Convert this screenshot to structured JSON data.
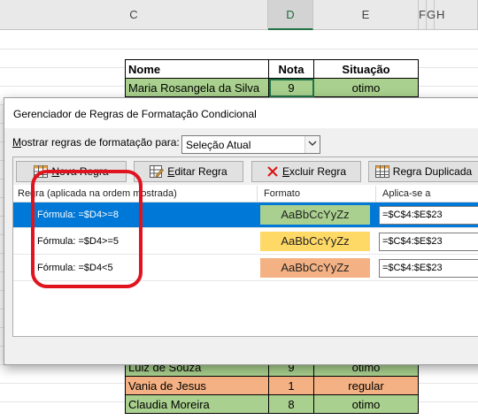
{
  "sheet": {
    "columns": [
      "C",
      "D",
      "E",
      "F",
      "G",
      "H"
    ],
    "table_header": {
      "name": "Nome",
      "grade": "Nota",
      "status": "Situação"
    },
    "rows_top": [
      {
        "name": "Maria Rosangela da Silva",
        "grade": "9",
        "status": "otimo",
        "color": "#a9d08e"
      }
    ],
    "rows_bottom": [
      {
        "name": "Luiz de Souza",
        "grade": "9",
        "status": "otimo",
        "color": "#a9d08e"
      },
      {
        "name": "Vania de Jesus",
        "grade": "1",
        "status": "regular",
        "color": "#f4b183"
      },
      {
        "name": "Claudia Moreira",
        "grade": "8",
        "status": "otimo",
        "color": "#a9d08e"
      }
    ]
  },
  "dialog": {
    "title": "Gerenciador de Regras de Formatação Condicional",
    "show_rules_label_prefix": "",
    "show_rules_underlined": "M",
    "show_rules_label_rest": "ostrar regras de formatação para:",
    "show_rules_value": "Seleção Atual",
    "buttons": {
      "new_rule_u": "N",
      "new_rule_rest": "ova Regra",
      "edit_rule_u": "E",
      "edit_rule_rest": "ditar Regra",
      "delete_rule_u": "E",
      "delete_rule_rest": "xcluir Regra",
      "duplicate_rule": "Regra Duplicada"
    },
    "list_headers": {
      "rule": "Regra (aplicada na ordem mostrada)",
      "format": "Formato",
      "applies_to": "Aplica-se a"
    },
    "rules": [
      {
        "text": "Fórmula: =$D4>=8",
        "preview": "AaBbCcYyZz",
        "color": "#a9d08e",
        "applies": "=$C$4:$E$23"
      },
      {
        "text": "Fórmula: =$D4>=5",
        "preview": "AaBbCcYyZz",
        "color": "#ffd966",
        "applies": "=$C$4:$E$23"
      },
      {
        "text": "Fórmula: =$D4<5",
        "preview": "AaBbCcYyZz",
        "color": "#f4b183",
        "applies": "=$C$4:$E$23"
      }
    ],
    "icons": {
      "new_rule": "table-grid-icon",
      "edit_rule": "edit-pencil-table-icon",
      "delete_rule": "red-x-icon",
      "duplicate_rule": "table-copy-icon",
      "dropdown": "chevron-down-icon"
    }
  }
}
